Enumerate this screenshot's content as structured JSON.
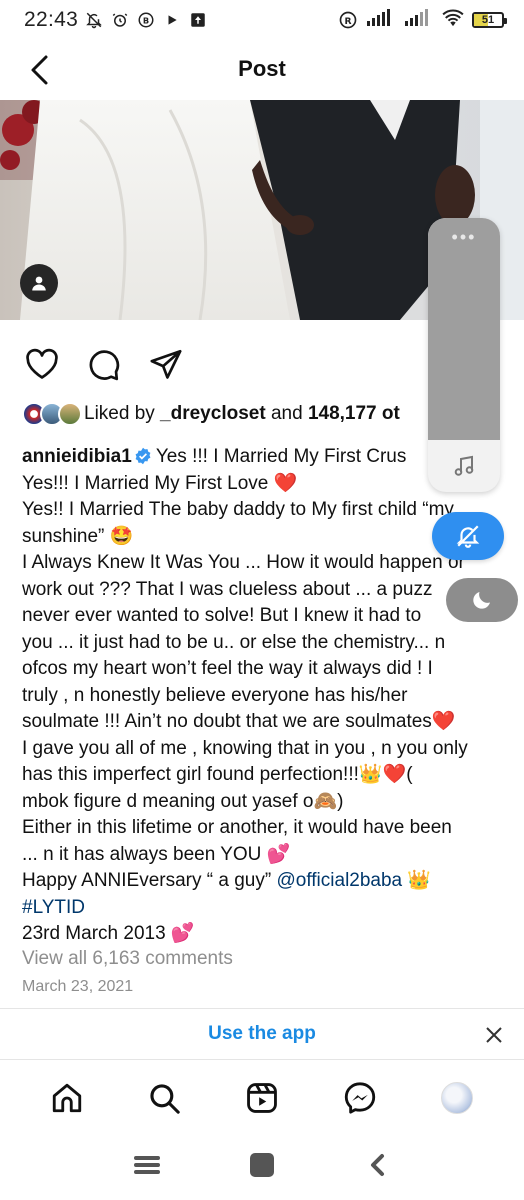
{
  "status_bar": {
    "time": "22:43",
    "battery": "51",
    "battery_level": 0.51
  },
  "header": {
    "title": "Post"
  },
  "likes": {
    "prefix": "Liked by ",
    "user": "_dreycloset",
    "middle": " and ",
    "count": "148,177 ot"
  },
  "caption": {
    "username": "annieidibia1",
    "lines": [
      "Yes !!! I Married My First Crus",
      "Yes!!! I Married My First Love ❤️",
      "Yes!! I Married The baby daddy to My first child “my",
      "sunshine” 🤩",
      "I Always Knew It Was You ... How it would happen or",
      "work out ??? That I was clueless about ... a puzz",
      "never ever wanted to solve! But I knew it had to",
      "you ... it just had to be u.. or else the chemistry... n",
      "ofcos my heart won’t feel the way it always did ! I",
      "truly , n honestly believe everyone has his/her",
      "soulmate !!! Ain’t no doubt that we are soulmates❤️",
      "I gave you all of me , knowing that in you , n you only",
      "has this imperfect girl found perfection!!!👑❤️(",
      "mbok figure d meaning out yasef o🙈)",
      "Either in this lifetime or another, it would have been",
      "... n it has always been YOU 💕"
    ],
    "happy_prefix": "Happy ANNIEversary “ a guy” ",
    "mention": "@official2baba",
    "happy_suffix": " 👑",
    "hashtag": "#LYTID",
    "date_line": "23rd March 2013 💕"
  },
  "comments": {
    "view_all": "View all 6,163 comments"
  },
  "post_date": "March 23, 2021",
  "app_banner": {
    "label": "Use the app"
  },
  "icons": {
    "back": "chevron-left-icon",
    "like": "heart-icon",
    "comment": "comment-icon",
    "share": "send-icon",
    "home": "home-icon",
    "search": "search-icon",
    "reels": "reels-icon",
    "messenger": "messenger-icon"
  },
  "colors": {
    "link": "#1a8ae2",
    "mention": "#00376b",
    "muted": "#8e8e8e",
    "overlay_blue": "#2f8ff0"
  }
}
